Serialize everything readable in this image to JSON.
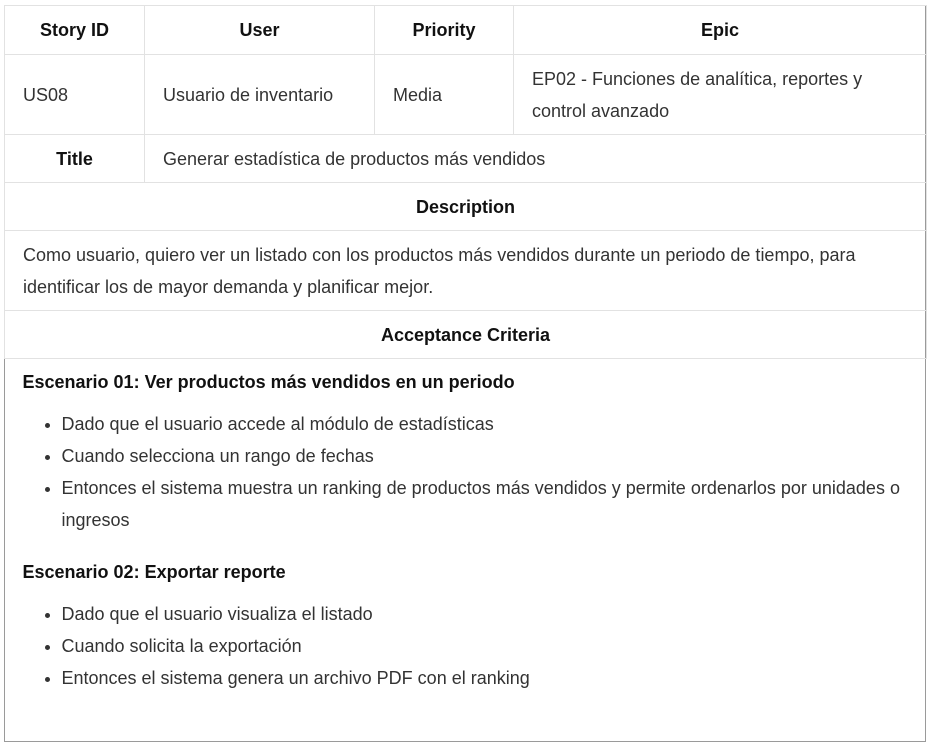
{
  "headers": {
    "story_id": "Story ID",
    "user": "User",
    "priority": "Priority",
    "epic": "Epic"
  },
  "story": {
    "id": "US08",
    "user": "Usuario de inventario",
    "priority": "Media",
    "epic": "EP02 - Funciones de analítica, reportes y control avanzado"
  },
  "title_label": "Title",
  "title": "Generar estadística de productos más vendidos",
  "description_label": "Description",
  "description": "Como usuario, quiero ver un listado con los productos más vendidos durante un periodo de tiempo, para identificar los de mayor demanda y planificar mejor.",
  "acceptance_label": "Acceptance Criteria",
  "scenarios": [
    {
      "title": "Escenario 01: Ver productos más vendidos en un periodo",
      "steps": [
        "Dado que el usuario accede al módulo de estadísticas",
        "Cuando selecciona un rango de fechas",
        "Entonces el sistema muestra un ranking de productos más vendidos y permite ordenarlos por unidades o ingresos"
      ]
    },
    {
      "title": "Escenario 02: Exportar reporte",
      "steps": [
        "Dado que el usuario visualiza el listado",
        "Cuando solicita la exportación",
        "Entonces el sistema genera un archivo PDF con el ranking"
      ]
    }
  ]
}
